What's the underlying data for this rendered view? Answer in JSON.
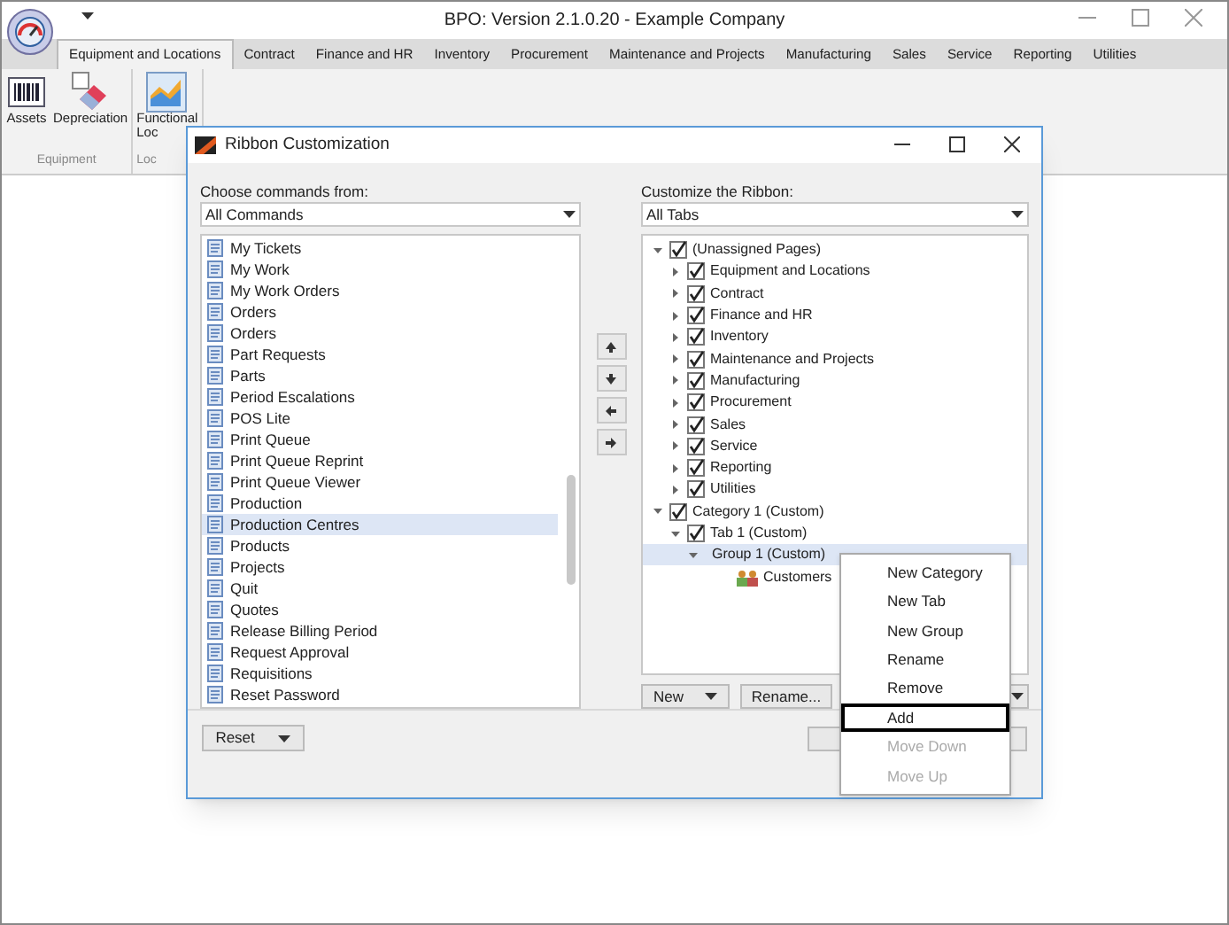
{
  "window": {
    "title": "BPO: Version 2.1.0.20 - Example Company"
  },
  "ribbon_tabs": [
    {
      "label": "Equipment and Locations",
      "selected": true
    },
    {
      "label": "Contract",
      "selected": false
    },
    {
      "label": "Finance and HR",
      "selected": false
    },
    {
      "label": "Inventory",
      "selected": false
    },
    {
      "label": "Procurement",
      "selected": false
    },
    {
      "label": "Maintenance and Projects",
      "selected": false
    },
    {
      "label": "Manufacturing",
      "selected": false
    },
    {
      "label": "Sales",
      "selected": false
    },
    {
      "label": "Service",
      "selected": false
    },
    {
      "label": "Reporting",
      "selected": false
    },
    {
      "label": "Utilities",
      "selected": false
    }
  ],
  "ribbon_groups": [
    {
      "label": "Equipment",
      "buttons": [
        {
          "kind": "barcode",
          "label": "Assets"
        },
        {
          "kind": "eraser",
          "label": "Depreciation"
        }
      ]
    },
    {
      "label": "Loc",
      "buttons": [
        {
          "kind": "chart",
          "label": "Functional Loc"
        }
      ]
    }
  ],
  "dialog": {
    "title": "Ribbon Customization",
    "left": {
      "label": "Choose commands from:",
      "dropdown": "All Commands",
      "commands": [
        {
          "label": "My Tickets",
          "selected": false
        },
        {
          "label": "My Work",
          "selected": false
        },
        {
          "label": "My Work Orders",
          "selected": false
        },
        {
          "label": "Orders",
          "selected": false
        },
        {
          "label": "Orders",
          "selected": false
        },
        {
          "label": "Part Requests",
          "selected": false
        },
        {
          "label": "Parts",
          "selected": false
        },
        {
          "label": "Period Escalations",
          "selected": false
        },
        {
          "label": "POS Lite",
          "selected": false
        },
        {
          "label": "Print Queue",
          "selected": false
        },
        {
          "label": "Print Queue Reprint",
          "selected": false
        },
        {
          "label": "Print Queue Viewer",
          "selected": false
        },
        {
          "label": "Production",
          "selected": false
        },
        {
          "label": "Production Centres",
          "selected": true
        },
        {
          "label": "Products",
          "selected": false
        },
        {
          "label": "Projects",
          "selected": false
        },
        {
          "label": "Quit",
          "selected": false
        },
        {
          "label": "Quotes",
          "selected": false
        },
        {
          "label": "Release Billing Period",
          "selected": false
        },
        {
          "label": "Request Approval",
          "selected": false
        },
        {
          "label": "Requisitions",
          "selected": false
        },
        {
          "label": "Reset Password",
          "selected": false
        }
      ]
    },
    "right": {
      "label": "Customize the Ribbon:",
      "dropdown": "All Tabs",
      "tree": [
        {
          "kind": "page",
          "label": "(Unassigned Pages)",
          "checked": true,
          "expanded": true,
          "selected": false,
          "children": [
            {
              "kind": "page",
              "label": "Equipment and Locations",
              "checked": true,
              "expanded": false,
              "selected": false
            },
            {
              "kind": "page",
              "label": "Contract",
              "checked": true,
              "expanded": false,
              "selected": false
            },
            {
              "kind": "page",
              "label": "Finance and HR",
              "checked": true,
              "expanded": false,
              "selected": false
            },
            {
              "kind": "page",
              "label": "Inventory",
              "checked": true,
              "expanded": false,
              "selected": false
            },
            {
              "kind": "page",
              "label": "Maintenance and Projects",
              "checked": true,
              "expanded": false,
              "selected": false
            },
            {
              "kind": "page",
              "label": "Manufacturing",
              "checked": true,
              "expanded": false,
              "selected": false
            },
            {
              "kind": "page",
              "label": "Procurement",
              "checked": true,
              "expanded": false,
              "selected": false
            },
            {
              "kind": "page",
              "label": "Sales",
              "checked": true,
              "expanded": false,
              "selected": false
            },
            {
              "kind": "page",
              "label": "Service",
              "checked": true,
              "expanded": false,
              "selected": false
            },
            {
              "kind": "page",
              "label": "Reporting",
              "checked": true,
              "expanded": false,
              "selected": false
            },
            {
              "kind": "page",
              "label": "Utilities",
              "checked": true,
              "expanded": false,
              "selected": false
            }
          ]
        },
        {
          "kind": "page",
          "label": "Category 1 (Custom)",
          "checked": true,
          "expanded": true,
          "selected": false,
          "children": [
            {
              "kind": "page",
              "label": "Tab 1 (Custom)",
              "checked": true,
              "expanded": true,
              "selected": false,
              "children": [
                {
                  "kind": "group",
                  "label": "Group 1 (Custom)",
                  "expanded": true,
                  "selected": true,
                  "children": [
                    {
                      "kind": "command",
                      "label": "Customers",
                      "selected": false
                    }
                  ]
                }
              ]
            }
          ]
        }
      ],
      "buttons": [
        {
          "label": "New"
        },
        {
          "label": "Rename..."
        }
      ]
    },
    "reset_button": "Reset",
    "context_menu": [
      {
        "label": "New Category",
        "disabled": false,
        "selected": false
      },
      {
        "label": "New Tab",
        "disabled": false,
        "selected": false
      },
      {
        "label": "New Group",
        "disabled": false,
        "selected": false
      },
      {
        "label": "Rename",
        "disabled": false,
        "selected": false
      },
      {
        "label": "Remove",
        "disabled": false,
        "selected": false
      },
      {
        "label": "Add",
        "disabled": false,
        "selected": true
      },
      {
        "label": "Move Down",
        "disabled": true,
        "selected": false
      },
      {
        "label": "Move Up",
        "disabled": true,
        "selected": false
      }
    ]
  }
}
